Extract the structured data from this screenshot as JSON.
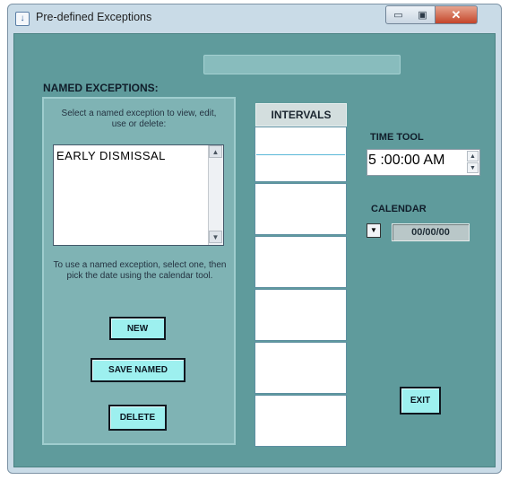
{
  "window": {
    "title": "Pre-defined Exceptions",
    "minimize_glyph": "▭",
    "maximize_glyph": "▣",
    "close_glyph": "✕",
    "app_icon": "arrow-down-icon",
    "app_icon_glyph": "↓"
  },
  "named_exceptions": {
    "heading": "NAMED EXCEPTIONS:",
    "instruction": "Select a named exception to view, edit, use or delete:",
    "items": [
      "EARLY DISMISSAL"
    ],
    "usage_note": "To use a named exception, select one, then pick the date using the calendar tool.",
    "scroll_up_glyph": "▲",
    "scroll_down_glyph": "▼"
  },
  "buttons": {
    "new": "NEW",
    "save_named": "SAVE NAMED",
    "delete": "DELETE",
    "exit": "EXIT"
  },
  "intervals": {
    "header": "INTERVALS",
    "rows": [
      "",
      "",
      "",
      "",
      "",
      ""
    ]
  },
  "time_tool": {
    "label": "TIME TOOL",
    "value": "5 :00:00 AM",
    "up_glyph": "▲",
    "down_glyph": "▼"
  },
  "calendar": {
    "label": "CALENDAR",
    "value": "00/00/00",
    "dropdown_glyph": "▼"
  },
  "colors": {
    "client_bg": "#5f9b9c",
    "panel_bg": "#7fb3b4",
    "button_bg": "#9df0ef"
  }
}
